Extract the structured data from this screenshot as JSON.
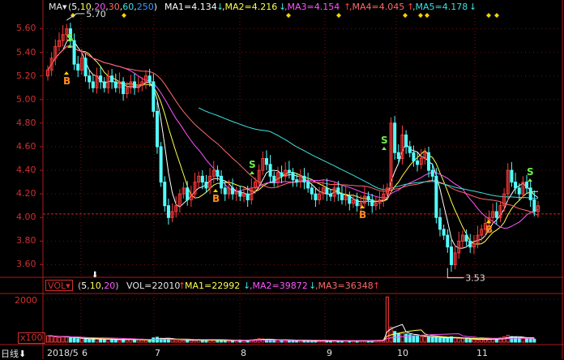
{
  "legend": {
    "indicator": "MA▾",
    "params": "(5,10,20,30,60,250)",
    "ma1": "MA1=4.134",
    "ma2": ",MA2=4.216",
    "ma3": ",MA3=4.154",
    "ma4": ",MA4=4.045",
    "ma5": ",MA5=4.178",
    "arrow_down": "↓",
    "arrow_up": "↑"
  },
  "vol_legend": {
    "badge": "VOL▾",
    "params": "(5,10,20)",
    "vol": "VOL=22010",
    "ma1": "MA1=22992",
    "ma2": ",MA2=39872",
    "ma3": ",MA3=36348",
    "arrow_down": "↓",
    "arrow_up": "↑"
  },
  "y_ticks": [
    "5.60",
    "5.40",
    "5.20",
    "5.00",
    "4.80",
    "4.60",
    "4.40",
    "4.20",
    "4.00",
    "3.80",
    "3.60"
  ],
  "vol_ticks": [
    "2000",
    "x100"
  ],
  "x_labels": [
    "2018/5",
    "6",
    "7",
    "8",
    "9",
    "10",
    "11"
  ],
  "daily_tab": "日线",
  "annotations": {
    "high": "5.70",
    "low": "3.53"
  },
  "signals": {
    "s": [
      "S",
      "S",
      "S",
      "S"
    ],
    "b": [
      "B",
      "B",
      "B",
      "B",
      "B"
    ]
  },
  "colors": {
    "up": "#ff3c3c",
    "down": "#54ffff",
    "ma5": "#ffffff",
    "ma10": "#ffff4e",
    "ma20": "#ff55ff",
    "ma30": "#ff6a6a",
    "ma60": "#3ce0e0",
    "axis": "#b01818",
    "ref_line": "#d22020"
  },
  "chart_data": {
    "type": "candlestick",
    "ylim": [
      3.5,
      5.72
    ],
    "last_close_ref": 4.03,
    "high_label": 5.7,
    "low_label": 3.53,
    "vol_ylim": [
      0,
      2300
    ],
    "closes": [
      5.25,
      5.35,
      5.45,
      5.5,
      5.55,
      5.6,
      5.5,
      5.3,
      5.25,
      5.35,
      5.2,
      5.15,
      5.1,
      5.2,
      5.15,
      5.1,
      5.2,
      5.15,
      5.1,
      5.15,
      5.05,
      5.1,
      5.15,
      5.1,
      5.12,
      5.15,
      5.2,
      5.15,
      4.9,
      4.6,
      4.3,
      4.1,
      4.0,
      4.05,
      4.1,
      4.2,
      4.25,
      4.15,
      4.2,
      4.3,
      4.35,
      4.3,
      4.25,
      4.35,
      4.4,
      4.35,
      4.25,
      4.2,
      4.25,
      4.2,
      4.22,
      4.18,
      4.2,
      4.15,
      4.25,
      4.3,
      4.4,
      4.5,
      4.45,
      4.35,
      4.3,
      4.38,
      4.35,
      4.4,
      4.38,
      4.32,
      4.3,
      4.35,
      4.3,
      4.25,
      4.2,
      4.15,
      4.2,
      4.25,
      4.2,
      4.18,
      4.25,
      4.2,
      4.15,
      4.18,
      4.12,
      4.15,
      4.1,
      4.12,
      4.18,
      4.15,
      4.1,
      4.12,
      4.15,
      4.2,
      4.25,
      4.8,
      4.55,
      4.5,
      4.7,
      4.6,
      4.55,
      4.48,
      4.45,
      4.5,
      4.55,
      4.4,
      4.35,
      4.0,
      3.9,
      3.85,
      3.75,
      3.6,
      3.7,
      3.8,
      3.85,
      3.8,
      3.75,
      3.78,
      3.85,
      3.9,
      3.95,
      4.0,
      4.05,
      4.0,
      4.1,
      4.2,
      4.4,
      4.3,
      4.25,
      4.2,
      4.3,
      4.25,
      4.15,
      4.05,
      4.1
    ],
    "volumes": [
      300,
      280,
      250,
      220,
      260,
      240,
      200,
      180,
      160,
      170,
      150,
      140,
      130,
      160,
      150,
      140,
      130,
      120,
      110,
      100,
      120,
      130,
      140,
      120,
      110,
      100,
      90,
      110,
      200,
      230,
      180,
      160,
      150,
      120,
      110,
      100,
      90,
      80,
      85,
      90,
      120,
      110,
      100,
      95,
      90,
      85,
      80,
      75,
      70,
      80,
      90,
      100,
      85,
      80,
      110,
      130,
      160,
      150,
      120,
      110,
      100,
      90,
      80,
      75,
      70,
      85,
      80,
      75,
      70,
      65,
      70,
      60,
      65,
      70,
      75,
      70,
      65,
      60,
      70,
      65,
      60,
      55,
      60,
      70,
      65,
      60,
      75,
      80,
      90,
      100,
      2100,
      700,
      500,
      400,
      420,
      380,
      350,
      300,
      280,
      260,
      250,
      240,
      230,
      220,
      200,
      190,
      180,
      250,
      200,
      180,
      160,
      150,
      130,
      120,
      110,
      130,
      140,
      150,
      160,
      170,
      200,
      250,
      320,
      260,
      230,
      200,
      180,
      160,
      150,
      140
    ]
  }
}
